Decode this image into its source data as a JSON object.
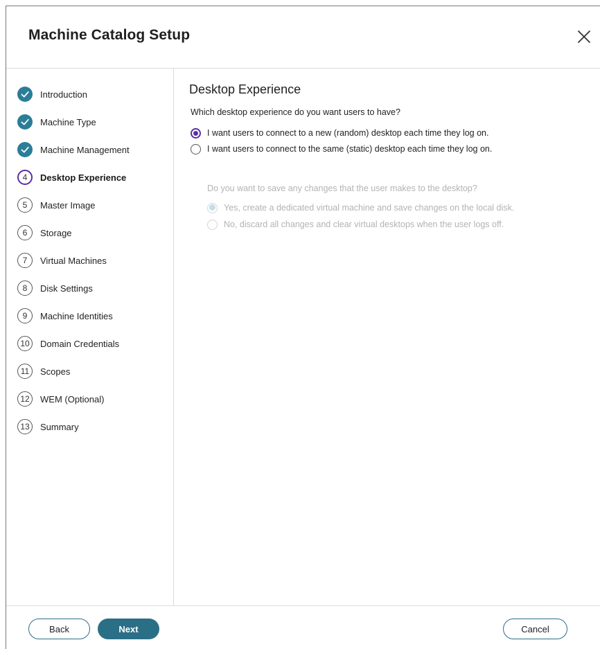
{
  "dialog": {
    "title": "Machine Catalog Setup"
  },
  "steps": [
    {
      "label": "Introduction",
      "status": "done"
    },
    {
      "label": "Machine Type",
      "status": "done"
    },
    {
      "label": "Machine Management",
      "status": "done"
    },
    {
      "label": "Desktop Experience",
      "number": "4",
      "status": "current"
    },
    {
      "label": "Master Image",
      "number": "5",
      "status": "pending"
    },
    {
      "label": "Storage",
      "number": "6",
      "status": "pending"
    },
    {
      "label": "Virtual Machines",
      "number": "7",
      "status": "pending"
    },
    {
      "label": "Disk Settings",
      "number": "8",
      "status": "pending"
    },
    {
      "label": "Machine Identities",
      "number": "9",
      "status": "pending"
    },
    {
      "label": "Domain Credentials",
      "number": "10",
      "status": "pending"
    },
    {
      "label": "Scopes",
      "number": "11",
      "status": "pending"
    },
    {
      "label": "WEM (Optional)",
      "number": "12",
      "status": "pending"
    },
    {
      "label": "Summary",
      "number": "13",
      "status": "pending"
    }
  ],
  "content": {
    "title": "Desktop Experience",
    "question": "Which desktop experience do you want users to have?",
    "options": [
      {
        "label": "I want users to connect to a new (random) desktop each time they log on.",
        "selected": true,
        "enabled": true
      },
      {
        "label": "I want users to connect to the same (static) desktop each time they log on.",
        "selected": false,
        "enabled": true
      }
    ],
    "sub_question": "Do you want to save any changes that the user makes to the desktop?",
    "sub_options": [
      {
        "label": "Yes, create a dedicated virtual machine and save changes on the local disk.",
        "selected": true,
        "enabled": false
      },
      {
        "label": "No, discard all changes and clear virtual desktops when the user logs off.",
        "selected": false,
        "enabled": false
      }
    ]
  },
  "footer": {
    "back_label": "Back",
    "next_label": "Next",
    "cancel_label": "Cancel"
  },
  "colors": {
    "accent": "#2b6f87",
    "done_step": "#2b7d98",
    "current_step": "#5a2ea6"
  },
  "icons": {
    "close": "close-icon",
    "done": "checkmark-icon"
  }
}
